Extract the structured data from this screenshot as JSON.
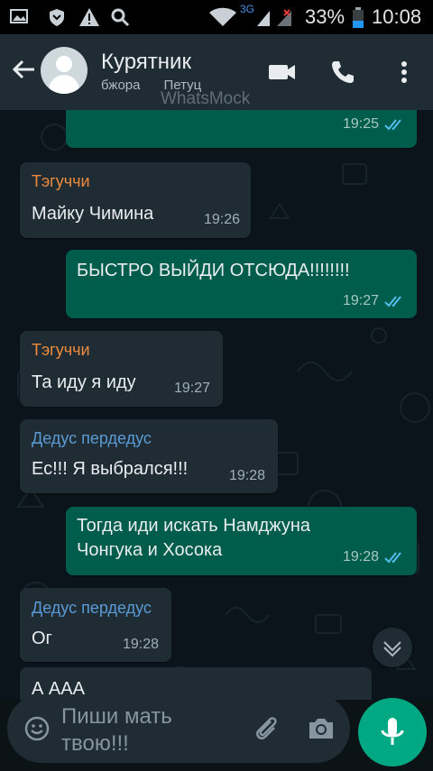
{
  "status_bar": {
    "network": "3G",
    "battery": "33%",
    "time": "10:08",
    "icons": [
      "gallery-icon",
      "shield-icon",
      "warning-icon",
      "search-icon",
      "wifi-icon",
      "signal-icon",
      "battery-icon"
    ]
  },
  "header": {
    "back_icon": "arrow-left-icon",
    "title": "Курятник",
    "members": [
      "бжора",
      "Петуц"
    ],
    "watermark": "WhatsMock",
    "actions": [
      "video-call-icon",
      "phone-icon",
      "more-vert-icon"
    ]
  },
  "messages": [
    {
      "direction": "out",
      "sender": "",
      "text": "",
      "time": "19:25",
      "status": "read"
    },
    {
      "direction": "in",
      "sender": "Тэгуччи",
      "text": "Майку Чимина",
      "time": "19:26"
    },
    {
      "direction": "out",
      "sender": "",
      "text": "БЫСТРО ВЫЙДИ ОТСЮДА!!!!!!!!",
      "time": "19:27",
      "status": "read"
    },
    {
      "direction": "in",
      "sender": "Тэгуччи",
      "text": "Та иду я иду",
      "time": "19:27"
    },
    {
      "direction": "in",
      "sender": "Дедус пердедус",
      "text": "Ес!!! Я выбрался!!!",
      "time": "19:28"
    },
    {
      "direction": "out",
      "sender": "",
      "text_lines": [
        "Тогда иди искать Намджуна",
        "Чонгука и Хосока"
      ],
      "time": "19:28",
      "status": "read"
    },
    {
      "direction": "in",
      "sender": "Дедус пердедус",
      "text": "Ог",
      "time": "19:28"
    },
    {
      "direction": "in",
      "sender": "",
      "text": "А ААА",
      "time": ""
    }
  ],
  "sender_colors": {
    "Тэгуччи": "#f08a3c",
    "Дедус пердедус": "#5b9bd5"
  },
  "colors": {
    "header_bg": "#1f2c34",
    "chat_bg": "#0b141a",
    "outgoing_bubble": "#005c4b",
    "incoming_bubble": "#1f2c34",
    "read_ticks": "#53bdeb",
    "mic_button": "#00a884"
  },
  "input": {
    "placeholder": "Пиши мать твою!!!",
    "emoji_icon": "emoji-icon",
    "attach_icon": "paperclip-icon",
    "camera_icon": "camera-icon",
    "mic_icon": "microphone-icon",
    "scroll_icon": "chevron-down-icon"
  }
}
